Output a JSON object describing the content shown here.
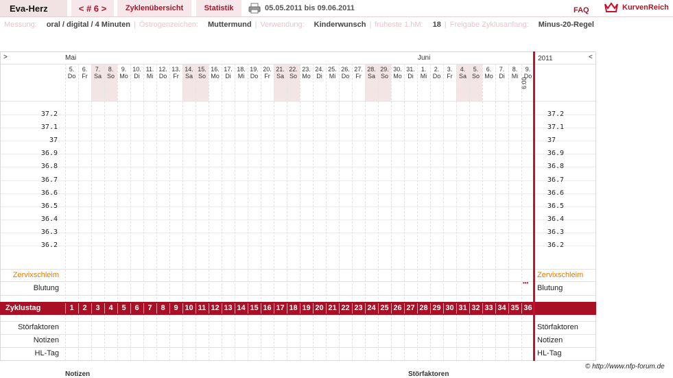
{
  "header": {
    "brand": "Eva-Herz",
    "cycle_nav": "< # 6 >",
    "tab_overview": "Zyklenübersicht",
    "tab_stats": "Statistik",
    "period": "05.05.2011 bis 09.06.2011",
    "faq": "FAQ",
    "logo_text": "KurvenReich"
  },
  "info": [
    {
      "label": "Messung:",
      "value": "oral / digital / 4 Minuten"
    },
    {
      "label": "Östrogenzeichen:",
      "value": "Muttermund"
    },
    {
      "label": "Verwendung:",
      "value": "Kinderwunsch"
    },
    {
      "label": "früheste 1.hM:",
      "value": "18"
    },
    {
      "label": "Freigabe Zyklusanfang:",
      "value": "Minus-20-Regel"
    }
  ],
  "chart": {
    "nav_left": ">",
    "nav_right": "<",
    "month_may": "Mai",
    "month_june": "Juni",
    "year": "2011",
    "time_label": "6:00",
    "days": [
      {
        "n": "5.",
        "d": "Do"
      },
      {
        "n": "6.",
        "d": "Fr"
      },
      {
        "n": "7.",
        "d": "Sa"
      },
      {
        "n": "8.",
        "d": "So"
      },
      {
        "n": "9.",
        "d": "Mo"
      },
      {
        "n": "10.",
        "d": "Di"
      },
      {
        "n": "11.",
        "d": "Mi"
      },
      {
        "n": "12.",
        "d": "Do"
      },
      {
        "n": "13.",
        "d": "Fr"
      },
      {
        "n": "14.",
        "d": "Sa"
      },
      {
        "n": "15.",
        "d": "So"
      },
      {
        "n": "16.",
        "d": "Mo"
      },
      {
        "n": "17.",
        "d": "Di"
      },
      {
        "n": "18.",
        "d": "Mi"
      },
      {
        "n": "19.",
        "d": "Do"
      },
      {
        "n": "20.",
        "d": "Fr"
      },
      {
        "n": "21.",
        "d": "Sa"
      },
      {
        "n": "22.",
        "d": "So"
      },
      {
        "n": "23.",
        "d": "Mo"
      },
      {
        "n": "24.",
        "d": "Di"
      },
      {
        "n": "25.",
        "d": "Mi"
      },
      {
        "n": "26.",
        "d": "Do"
      },
      {
        "n": "27.",
        "d": "Fr"
      },
      {
        "n": "28.",
        "d": "Sa"
      },
      {
        "n": "29.",
        "d": "So"
      },
      {
        "n": "30.",
        "d": "Mo"
      },
      {
        "n": "31.",
        "d": "Di"
      },
      {
        "n": "1.",
        "d": "Mi"
      },
      {
        "n": "2.",
        "d": "Do"
      },
      {
        "n": "3.",
        "d": "Fr"
      },
      {
        "n": "4.",
        "d": "Sa"
      },
      {
        "n": "5.",
        "d": "So"
      },
      {
        "n": "6.",
        "d": "Mo"
      },
      {
        "n": "7.",
        "d": "Di"
      },
      {
        "n": "8.",
        "d": "Mi"
      },
      {
        "n": "9.",
        "d": "Do"
      }
    ],
    "temperatures": [
      "37.2",
      "37.1",
      "37",
      "36.9",
      "36.8",
      "36.7",
      "36.6",
      "36.5",
      "36.4",
      "36.3",
      "36.2"
    ],
    "labels": {
      "cervix": "Zervixschleim",
      "bleeding": "Blutung",
      "cycle_day": "Zyklustag",
      "disturbances": "Störfaktoren",
      "notes": "Notizen",
      "hl_day": "HL-Tag"
    },
    "bleeding_marker": "•••",
    "colors": {
      "accent": "#a90f25",
      "weekend": "#f3e4e6",
      "cervix_label": "#e07b00"
    }
  },
  "footer": {
    "copyright": "© http://www.nfp-forum.de",
    "notes": "Notizen",
    "disturbances": "Störfaktoren"
  }
}
